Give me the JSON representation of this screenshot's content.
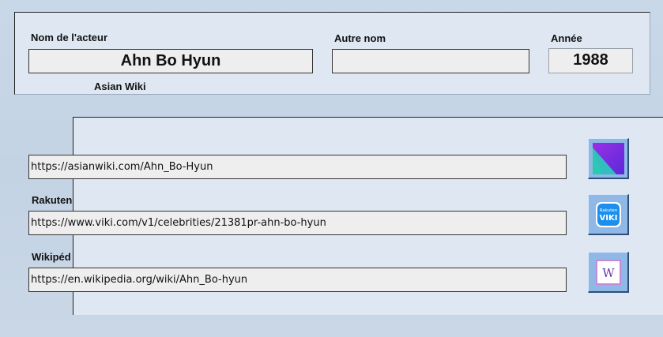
{
  "header": {
    "actor_label": "Nom de l'acteur",
    "actor_value": "Ahn Bo Hyun",
    "other_name_label": "Autre nom",
    "other_name_value": "",
    "year_label": "Année",
    "year_value": "1988"
  },
  "links": [
    {
      "label": "Asian Wiki",
      "url": "https://asianwiki.com/Ahn_Bo-Hyun",
      "icon": "asianwiki-icon"
    },
    {
      "label": "Rakuten",
      "url": "https://www.viki.com/v1/celebrities/21381pr-ahn-bo-hyun",
      "icon": "rakuten-viki-icon",
      "icon_text_top": "Rakuten",
      "icon_text_main": "VIKI"
    },
    {
      "label": "Wikipéd",
      "url": "https://en.wikipedia.org/wiki/Ahn_Bo-hyun",
      "icon": "wikipedia-icon",
      "icon_text_main": "W"
    }
  ],
  "colors": {
    "background": "#c9d8e8",
    "panel": "#dfe8f2",
    "field": "#eeeeee",
    "button": "#8fb8e6",
    "asianwiki_purple": "#7a2ce0",
    "asianwiki_teal": "#2ec8b0",
    "viki_blue": "#1a8ff0"
  }
}
